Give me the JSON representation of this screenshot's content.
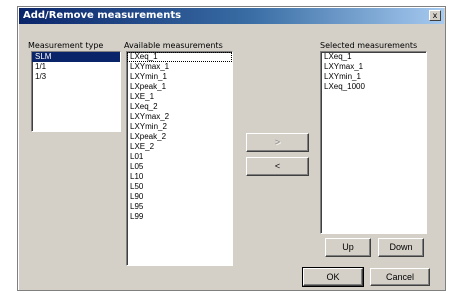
{
  "window": {
    "title": "Add/Remove measurements",
    "close_glyph": "x"
  },
  "measurement_type": {
    "label": "Measurement type",
    "items": [
      {
        "label": "SLM",
        "selected": true
      },
      {
        "label": "1/1",
        "selected": false
      },
      {
        "label": "1/3",
        "selected": false
      }
    ]
  },
  "available": {
    "label": "Available measurements",
    "items": [
      "LXeq_1",
      "LXYmax_1",
      "LXYmin_1",
      "LXpeak_1",
      "LXE_1",
      "LXeq_2",
      "LXYmax_2",
      "LXYmin_2",
      "LXpeak_2",
      "LXE_2",
      "L01",
      "L05",
      "L10",
      "L50",
      "L90",
      "L95",
      "L99"
    ]
  },
  "move": {
    "add_label": ">",
    "remove_label": "<"
  },
  "selected": {
    "label": "Selected measurements",
    "items": [
      "LXeq_1",
      "LXYmax_1",
      "LXYmin_1",
      "LXeq_1000"
    ]
  },
  "buttons": {
    "up": "Up",
    "down": "Down",
    "ok": "OK",
    "cancel": "Cancel"
  },
  "colors": {
    "title_bar_start": "#0a246a",
    "title_bar_end": "#a6caf0",
    "dialog_face": "#d4d0c8",
    "selection": "#0a246a"
  }
}
